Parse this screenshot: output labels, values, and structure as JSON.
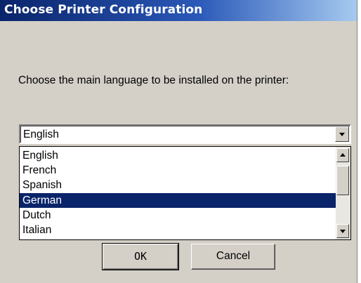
{
  "window": {
    "title": "Choose Printer Configuration"
  },
  "prompt": "Choose the main language to be installed on the printer:",
  "language_select": {
    "selected_value": "English",
    "options": [
      "English",
      "French",
      "Spanish",
      "German",
      "Dutch",
      "Italian"
    ],
    "highlighted": "German"
  },
  "buttons": {
    "ok": "OK",
    "cancel": "Cancel"
  },
  "icons": {
    "dropdown": "chevron-down-icon",
    "scroll_up": "scroll-up-arrow-icon",
    "scroll_down": "scroll-down-arrow-icon"
  },
  "colors": {
    "titlebar": "#0a246a",
    "selection": "#0a246a",
    "dialog_bg": "#d4d0c8"
  }
}
